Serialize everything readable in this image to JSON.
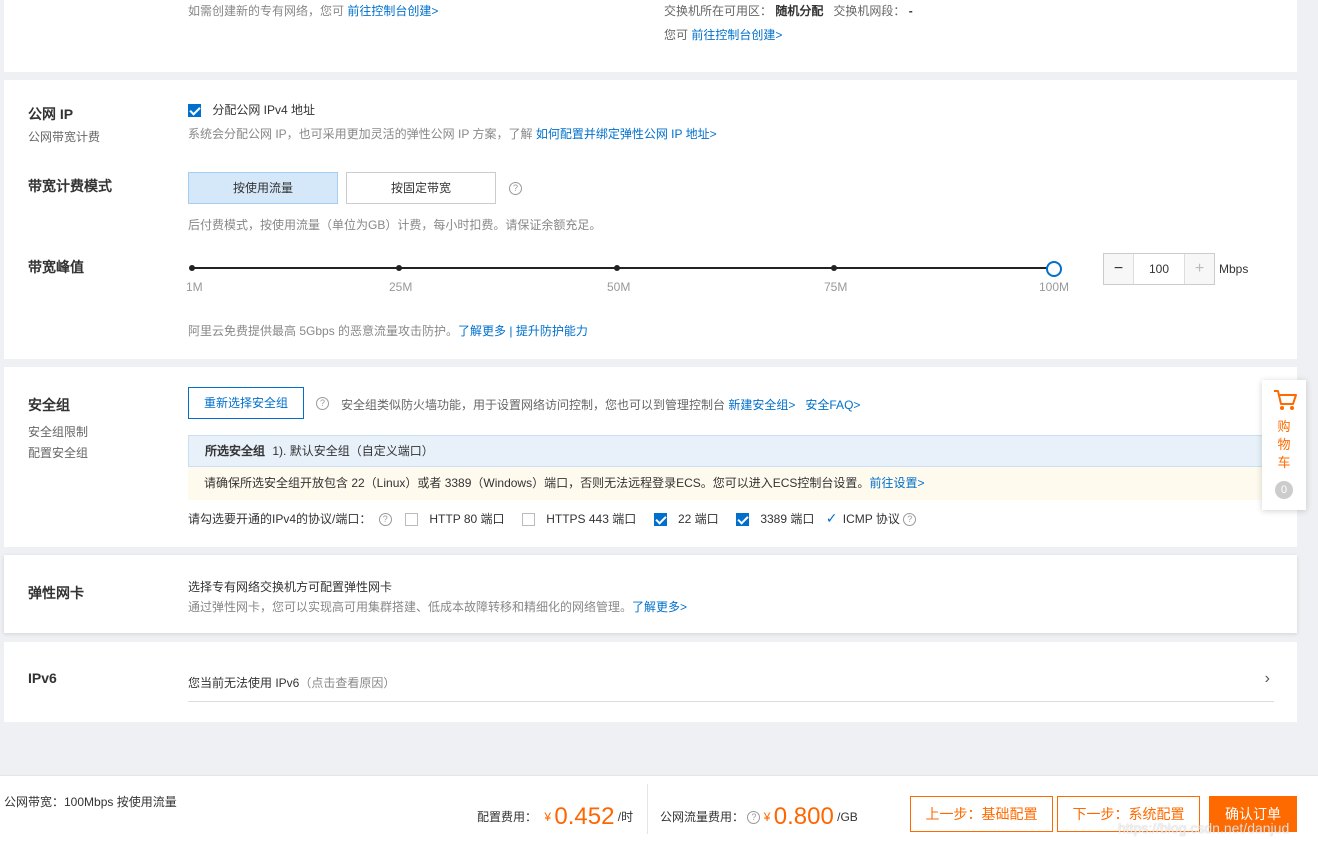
{
  "vpc": {
    "create_hint": "如需创建新的专有网络，您可",
    "create_link": "前往控制台创建>",
    "zone_label": "交换机所在可用区：",
    "zone_value": "随机分配",
    "cidr_label": "交换机网段：",
    "cidr_value": "-",
    "switch_hint": "您可",
    "switch_link": "前往控制台创建>"
  },
  "public_ip": {
    "title": "公网 IP",
    "subtitle": "公网带宽计费",
    "assign_label": "分配公网 IPv4 地址",
    "assign_checked": true,
    "desc": "系统会分配公网 IP，也可采用更加灵活的弹性公网 IP 方案，了解",
    "desc_link": "如何配置并绑定弹性公网 IP 地址>"
  },
  "billing": {
    "title": "带宽计费模式",
    "options": [
      "按使用流量",
      "按固定带宽"
    ],
    "selected": "按使用流量",
    "desc": "后付费模式，按使用流量（单位为GB）计费，每小时扣费。请保证余额充足。"
  },
  "bandwidth": {
    "title": "带宽峰值",
    "ticks": [
      "1M",
      "25M",
      "50M",
      "75M",
      "100M"
    ],
    "value": "100",
    "unit": "Mbps",
    "minus": "−",
    "plus": "+",
    "protect_desc": "阿里云免费提供最高 5Gbps 的恶意流量攻击防护。",
    "learn_more": "了解更多",
    "separator": "|",
    "upgrade": "提升防护能力"
  },
  "security": {
    "title": "安全组",
    "sub1": "安全组限制",
    "sub2": "配置安全组",
    "reselect_button": "重新选择安全组",
    "desc": "安全组类似防火墙功能，用于设置网络访问控制，您也可以到管理控制台",
    "new_link": "新建安全组>",
    "faq_link": "安全FAQ>",
    "selected_label": "所选安全组",
    "selected_value": "1). 默认安全组（自定义端口）",
    "warning": "请确保所选安全组开放包含 22（Linux）或者 3389（Windows）端口，否则无法远程登录ECS。您可以进入ECS控制台设置。",
    "warning_link": "前往设置>",
    "ports_label": "请勾选要开通的IPv4的协议/端口：",
    "ports": [
      {
        "label": "HTTP 80 端口",
        "checked": false
      },
      {
        "label": "HTTPS 443 端口",
        "checked": false
      },
      {
        "label": "22 端口",
        "checked": true
      },
      {
        "label": "3389 端口",
        "checked": true
      }
    ],
    "icmp_label": "ICMP 协议"
  },
  "eni": {
    "title": "弹性网卡",
    "line1": "选择专有网络交换机方可配置弹性网卡",
    "line2": "通过弹性网卡，您可以实现高可用集群搭建、低成本故障转移和精细化的网络管理。",
    "link": "了解更多>"
  },
  "ipv6": {
    "title": "IPv6",
    "text": "您当前无法使用 IPv6",
    "reason": "（点击查看原因）"
  },
  "cart": {
    "label_1": "购",
    "label_2": "物",
    "label_3": "车",
    "count": "0"
  },
  "footer": {
    "summary": "公网带宽：100Mbps 按使用流量",
    "config_fee_label": "配置费用：",
    "currency": "¥",
    "config_fee": "0.452",
    "config_unit": "/时",
    "traffic_fee_label": "公网流量费用：",
    "traffic_fee": "0.800",
    "traffic_unit": "/GB",
    "prev_button": "上一步：基础配置",
    "next_button": "下一步：系统配置",
    "confirm_button": "确认订单",
    "watermark": "https://blog.csdn.net/danjud"
  },
  "colors": {
    "link": "#0070cc",
    "orange": "#ff6a00",
    "price": "#f60"
  }
}
